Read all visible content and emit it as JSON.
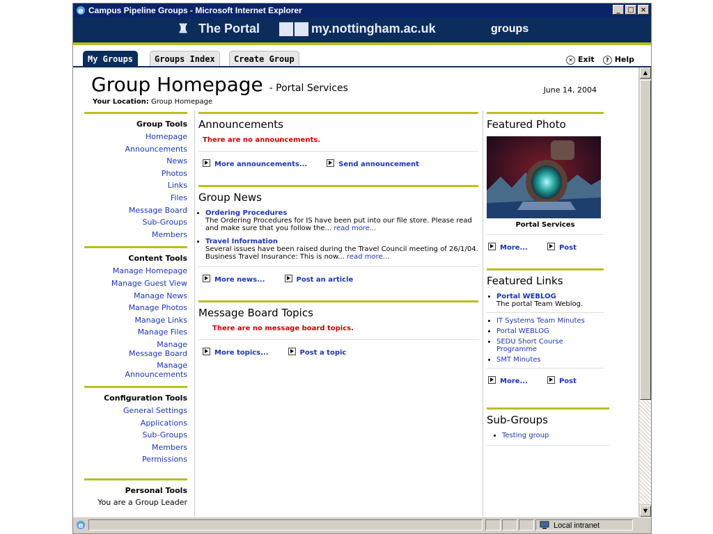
{
  "window": {
    "title": "Campus Pipeline Groups - Microsoft Internet Explorer"
  },
  "banner": {
    "portal": "The Portal",
    "site": "my.nottingham.ac.uk",
    "groups": "groups"
  },
  "tabs": [
    "My Groups",
    "Groups Index",
    "Create Group"
  ],
  "header_tools": {
    "exit": "Exit",
    "help": "Help"
  },
  "page": {
    "title": "Group Homepage",
    "subtitle": "- Portal Services",
    "location_label": "Your Location:",
    "location_value": "Group Homepage",
    "date": "June 14, 2004"
  },
  "sidebar": {
    "group_tools": {
      "title": "Group Tools",
      "items": [
        "Homepage",
        "Announcements",
        "News",
        "Photos",
        "Links",
        "Files",
        "Message Board",
        "Sub-Groups",
        "Members"
      ]
    },
    "content_tools": {
      "title": "Content Tools",
      "items": [
        "Manage Homepage",
        "Manage Guest View",
        "Manage News",
        "Manage Photos",
        "Manage Links",
        "Manage Files"
      ],
      "mb_1": "Manage",
      "mb_2": "Message Board",
      "an_1": "Manage",
      "an_2": "Announcements"
    },
    "config_tools": {
      "title": "Configuration Tools",
      "items": [
        "General Settings",
        "Applications",
        "Sub-Groups",
        "Members",
        "Permissions"
      ]
    },
    "personal_tools": {
      "title": "Personal Tools",
      "status": "You are a Group Leader"
    }
  },
  "announcements": {
    "title": "Announcements",
    "empty": "There are no announcements.",
    "more": "More announcements...",
    "send": "Send announcement"
  },
  "news": {
    "title": "Group News",
    "items": [
      {
        "title": "Ordering Procedures",
        "body": "The Ordering Procedures for IS have been put into our file store.  Please read and make sure that you follow the...",
        "more": "read more..."
      },
      {
        "title": "Travel Information",
        "body": "Several issues have been raised during the Travel Council meeting of 26/1/04. Business Travel Insurance: This is now...",
        "more": "read more..."
      }
    ],
    "more": "More news...",
    "post": "Post an article"
  },
  "message_board": {
    "title": "Message Board Topics",
    "empty": "There are no message board topics.",
    "more": "More topics...",
    "post": "Post a topic"
  },
  "featured_photo": {
    "title": "Featured Photo",
    "caption": "Portal Services",
    "more": "More...",
    "post": "Post"
  },
  "featured_links": {
    "title": "Featured Links",
    "top_title": "Portal WEBLOG",
    "top_desc": "The portal Team Weblog.",
    "items": [
      "IT Systems Team Minutes",
      "Portal WEBLOG",
      "SEDU Short Course Programme",
      "SMT Minutes"
    ],
    "more": "More...",
    "post": "Post"
  },
  "subgroups": {
    "title": "Sub-Groups",
    "items": [
      "Testing group"
    ]
  },
  "statusbar": {
    "zone": "Local intranet"
  }
}
